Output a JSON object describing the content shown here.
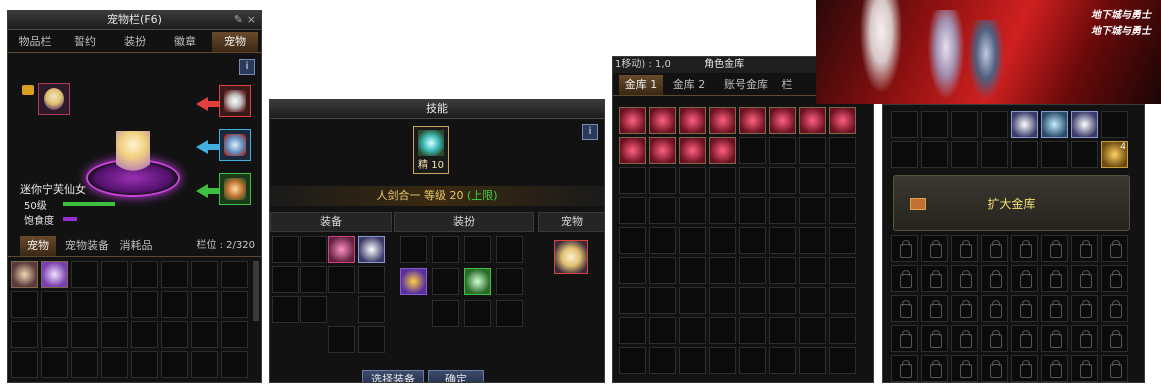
{
  "pet_panel": {
    "title": "宠物栏(F6)",
    "tabs": [
      "物品栏",
      "誓约",
      "装扮",
      "徽章",
      "宠物"
    ],
    "pet_name": "迷你宁芙仙女",
    "level_label": "50级",
    "satiety_label": "饱食度",
    "bottom_tabs": [
      "宠物",
      "宠物装备",
      "消耗品"
    ],
    "slot_count_label": "栏位 : 2/320",
    "info_icon": "i",
    "colors": {
      "level_bar": "#3fbf3f",
      "satiety_bar": "#9a2fd0",
      "arrow_red": "#e04040",
      "arrow_blue": "#40b0e0",
      "arrow_green": "#3fbf3f"
    }
  },
  "skill_panel": {
    "title": "技能",
    "skill_badge": "精 10",
    "skill_line": "人剑合一  等级 20",
    "skill_limit": "(上限)",
    "section_equip": "装备",
    "section_costume": "装扮",
    "section_pet": "宠物",
    "select_button": "选择装备",
    "confirm_button": "确定",
    "info_icon": "i"
  },
  "vault_panel": {
    "tabs": [
      "金库 1",
      "金库 2",
      "账号金库",
      "栏"
    ],
    "header_partial": "1移动) : 1,0",
    "header_title": "角色金库"
  },
  "account_vault": {
    "expand_button": "扩大金库",
    "item_count": "4"
  },
  "banner": {
    "logo_text_1": "地下城与勇士",
    "logo_text_2": "地下城与勇士"
  }
}
